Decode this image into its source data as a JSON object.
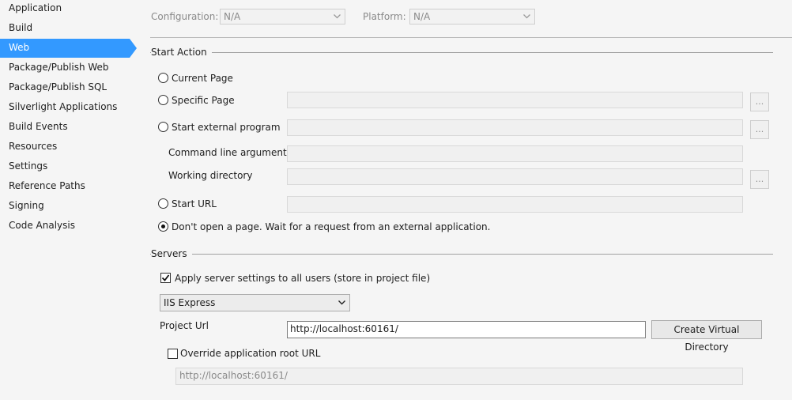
{
  "sidebar": {
    "items": [
      {
        "label": "Application"
      },
      {
        "label": "Build"
      },
      {
        "label": "Web"
      },
      {
        "label": "Package/Publish Web"
      },
      {
        "label": "Package/Publish SQL"
      },
      {
        "label": "Silverlight Applications"
      },
      {
        "label": "Build Events"
      },
      {
        "label": "Resources"
      },
      {
        "label": "Settings"
      },
      {
        "label": "Reference Paths"
      },
      {
        "label": "Signing"
      },
      {
        "label": "Code Analysis"
      }
    ],
    "active": "Web"
  },
  "config": {
    "configuration_label": "Configuration:",
    "configuration_value": "N/A",
    "platform_label": "Platform:",
    "platform_value": "N/A"
  },
  "start_action": {
    "title": "Start Action",
    "current_page": "Current Page",
    "specific_page": "Specific Page",
    "specific_page_value": "",
    "start_external_program": "Start external program",
    "external_program_value": "",
    "command_line_arguments": "Command line arguments",
    "command_line_value": "",
    "working_directory": "Working directory",
    "working_directory_value": "",
    "start_url": "Start URL",
    "start_url_value": "",
    "dont_open": "Don't open a page.  Wait for a request from an external application.",
    "browse_label": "...",
    "selected": "dont_open"
  },
  "servers": {
    "title": "Servers",
    "apply_settings_label": "Apply server settings to all users (store in project file)",
    "apply_settings_checked": true,
    "server_value": "IIS Express",
    "project_url_label": "Project Url",
    "project_url_value": "http://localhost:60161/",
    "create_virtual_directory": "Create Virtual Directory",
    "override_label": "Override application root URL",
    "override_checked": false,
    "override_value": "http://localhost:60161/"
  },
  "icons": {
    "chevron": "chevron-down-icon"
  }
}
